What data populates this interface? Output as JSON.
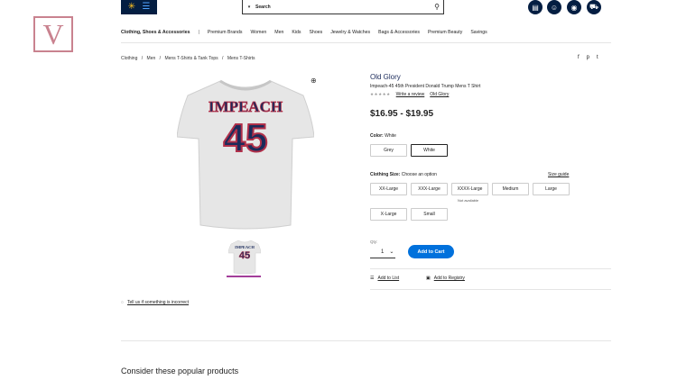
{
  "header": {
    "search_placeholder": "Search",
    "icons": [
      "reorder-icon",
      "account-icon",
      "location-icon",
      "cart-icon"
    ]
  },
  "watermark": "V",
  "category_nav": {
    "title": "Clothing, Shoes & Accessories",
    "items": [
      "Premium Brands",
      "Women",
      "Men",
      "Kids",
      "Shoes",
      "Jewelry & Watches",
      "Bags & Accessories",
      "Premium Beauty",
      "Savings"
    ]
  },
  "breadcrumb": [
    "Clothing",
    "/",
    "Men",
    "/",
    "Mens T-Shirts & Tank Tops",
    "/",
    "Mens T-Shirts"
  ],
  "social": {
    "facebook": "f",
    "pinterest": "p",
    "twitter": "t"
  },
  "shirt_graphic": {
    "line1": "IMPEACH",
    "line2": "45"
  },
  "product": {
    "brand": "Old Glory",
    "title": "Impeach-45 45th President Donald Trump Mens T Shirt",
    "stars": "★★★★★",
    "write_review": "Write a review",
    "brand_link": "Old Glory",
    "price": "$16.95 - $19.95"
  },
  "color": {
    "label": "Color:",
    "value": "White",
    "options": [
      "Grey",
      "White"
    ],
    "selected": "White"
  },
  "size": {
    "label": "Clothing Size:",
    "value": "Choose an option",
    "guide": "Size guide",
    "options": [
      "XX-Large",
      "XXX-Large",
      "XXXX-Large",
      "Medium",
      "Large",
      "X-Large",
      "Small"
    ],
    "not_available": "Not available"
  },
  "purchase": {
    "qty_label": "Qty:",
    "qty_value": "1",
    "add_to_cart": "Add to Cart"
  },
  "lists": {
    "add_to_list": "Add to List",
    "add_to_registry": "Add to Registry"
  },
  "report": "Tell us if something is incorrect",
  "popular": "Consider these popular products",
  "colors": {
    "navy": "#041e42",
    "blue": "#0071dc",
    "yellow": "#ffc220",
    "thumb_bar": "#a33e9a",
    "shirt_red": "#b0304a",
    "shirt_navy": "#1b2b5b"
  }
}
